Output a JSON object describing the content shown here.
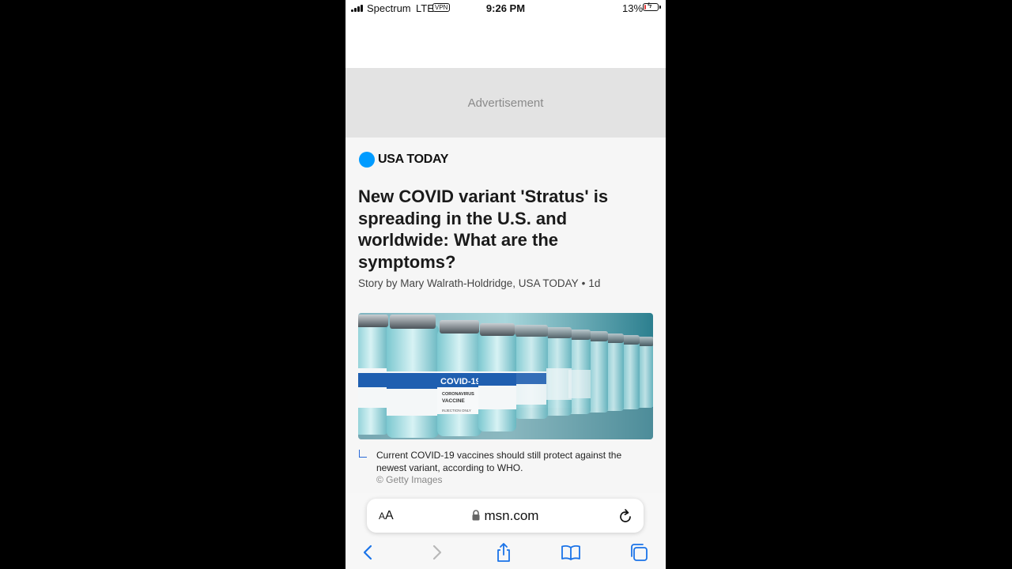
{
  "status_bar": {
    "carrier": "Spectrum",
    "network": "LTE",
    "vpn": "VPN",
    "time": "9:26 PM",
    "battery_percent": "13%",
    "battery_level": 0.13,
    "battery_color": "#e23b3b"
  },
  "ad": {
    "label": "Advertisement"
  },
  "article": {
    "brand": "USA TODAY",
    "brand_color": "#009bff",
    "headline": "New COVID variant 'Stratus' is spreading in the U.S. and worldwide: What are the symptoms?",
    "byline_author": "Story by Mary Walrath-Holdridge, USA TODAY",
    "byline_sep": "•",
    "byline_age": "1d",
    "image": {
      "vial_label": "COVID-19",
      "vial_sub1": "CORONAVIRUS",
      "vial_sub2": "VACCINE",
      "vial_sub3": "INJECTION ONLY"
    },
    "caption": "Current COVID-19 vaccines should still protect against the newest variant, according to WHO.",
    "credit": "© Getty Images"
  },
  "browser": {
    "text_size_big": "A",
    "text_size_small": "A",
    "url": "msn.com",
    "icons": [
      "lock-icon",
      "reload-icon",
      "back-icon",
      "forward-icon",
      "share-icon",
      "bookmarks-icon",
      "tabs-icon"
    ]
  }
}
